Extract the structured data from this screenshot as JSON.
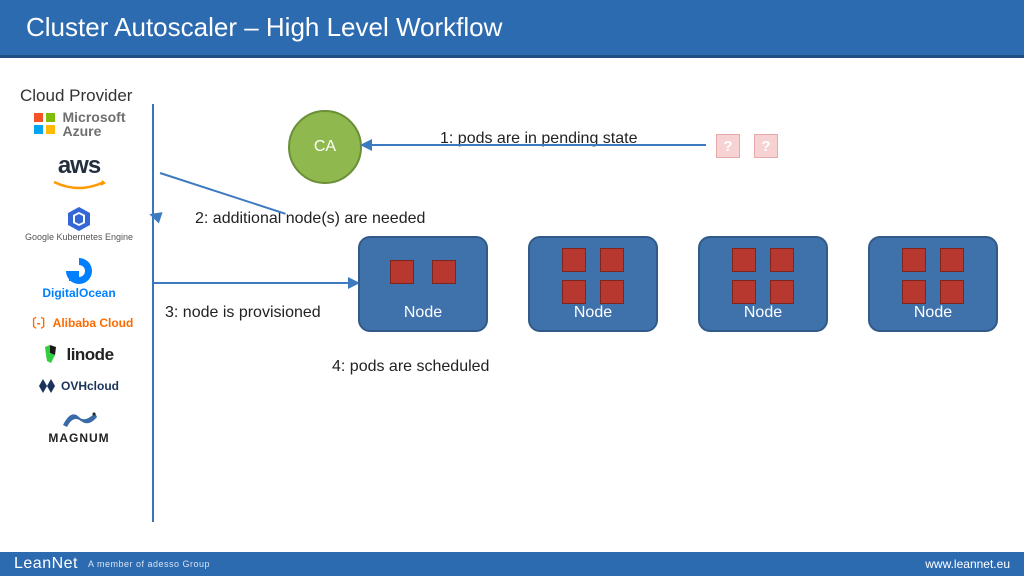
{
  "title": "Cluster Autoscaler – High Level Workflow",
  "cloud_provider_heading": "Cloud Provider",
  "providers": {
    "azure": {
      "line1": "Microsoft",
      "line2": "Azure"
    },
    "aws": "aws",
    "gke": "Google Kubernetes Engine",
    "digitalocean": "DigitalOcean",
    "alibaba": "〔-〕Alibaba Cloud",
    "linode": "linode",
    "ovh": "OVHcloud",
    "magnum": "MAGNUM"
  },
  "ca_label": "CA",
  "steps": {
    "s1": "1: pods are in pending state",
    "s2": "2: additional node(s) are needed",
    "s3": "3: node is provisioned",
    "s4": "4: pods are scheduled"
  },
  "pending_pod_glyph": "?",
  "nodes": [
    {
      "label": "Node",
      "pods": 2
    },
    {
      "label": "Node",
      "pods": 4
    },
    {
      "label": "Node",
      "pods": 4
    },
    {
      "label": "Node",
      "pods": 4
    }
  ],
  "footer": {
    "brand": "LeanNet",
    "tagline": "A member of adesso Group",
    "url": "www.leannet.eu"
  },
  "colors": {
    "bar": "#2d6bb1",
    "ca_fill": "#8fb94f",
    "node_fill": "#3f72ab",
    "pod_fill": "#b6382e",
    "pending_pod_fill": "#f6d2d2"
  }
}
